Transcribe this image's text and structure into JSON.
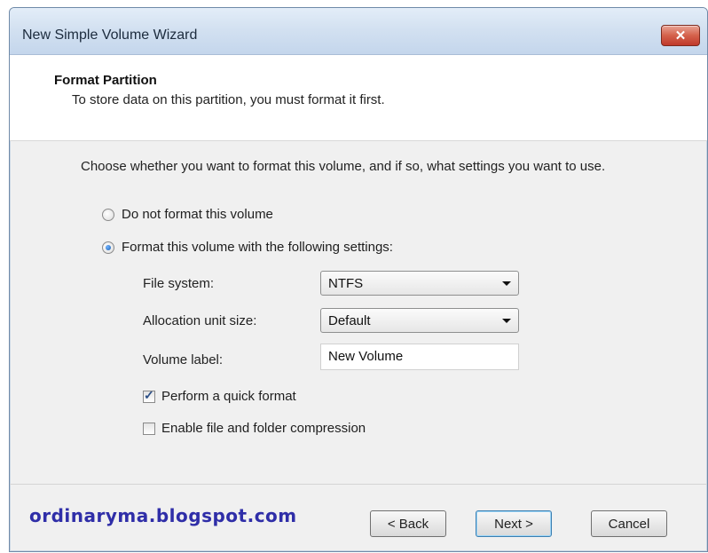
{
  "window": {
    "title": "New Simple Volume Wizard",
    "close_glyph": "✕"
  },
  "header": {
    "title": "Format Partition",
    "subtitle": "To store data on this partition, you must format it first."
  },
  "instruction": "Choose whether you want to format this volume, and if so, what settings you want to use.",
  "options": {
    "no_format_label": "Do not format this volume",
    "format_label": "Format this volume with the following settings:",
    "selected": "format"
  },
  "fields": {
    "file_system": {
      "label": "File system:",
      "value": "NTFS"
    },
    "allocation": {
      "label": "Allocation unit size:",
      "value": "Default"
    },
    "volume_label": {
      "label": "Volume label:",
      "value": "New Volume"
    }
  },
  "checks": {
    "quick_format": {
      "label": "Perform a quick format",
      "checked": true
    },
    "compression": {
      "label": "Enable file and folder compression",
      "checked": false
    }
  },
  "watermark": "ordinaryma.blogspot.com",
  "buttons": {
    "back": "< Back",
    "next": "Next >",
    "cancel": "Cancel"
  },
  "colors": {
    "watermark": "#2f2ea8",
    "close_button": "#c0392b",
    "title_bar": "#d3e1f1"
  }
}
